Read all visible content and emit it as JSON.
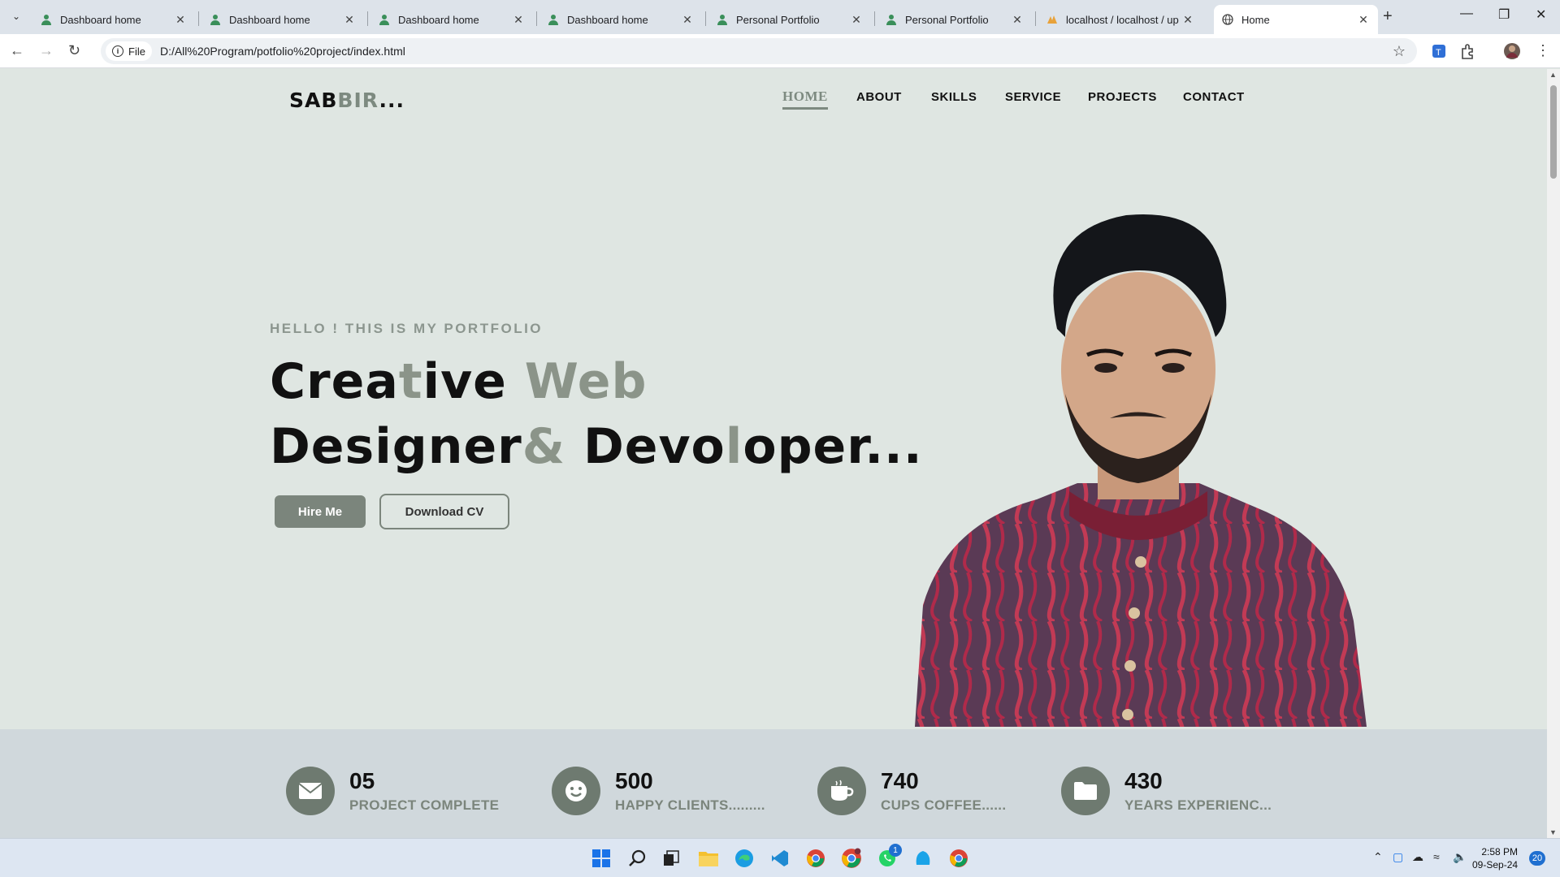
{
  "browser": {
    "tabs": [
      {
        "title": "Dashboard home",
        "icon": "person-icon"
      },
      {
        "title": "Dashboard home",
        "icon": "person-icon"
      },
      {
        "title": "Dashboard home",
        "icon": "person-icon"
      },
      {
        "title": "Dashboard home",
        "icon": "person-icon"
      },
      {
        "title": "Personal Portfolio",
        "icon": "person-icon"
      },
      {
        "title": "Personal Portfolio",
        "icon": "person-icon"
      },
      {
        "title": "localhost / localhost / up",
        "icon": "phpmyadmin-icon"
      },
      {
        "title": "Home",
        "icon": "globe-icon"
      }
    ],
    "active_tab": 7,
    "site_chip": "File",
    "url": "D:/All%20Program/potfolio%20project/index.html"
  },
  "page": {
    "logo": {
      "main": "SAB",
      "accent": "BIR",
      "suffix": "..."
    },
    "nav": [
      "HOME",
      "ABOUT",
      "SKILLS",
      "SERVICE",
      "PROJECTS",
      "CONTACT"
    ],
    "nav_active": "HOME",
    "hello": "HELLO ! THIS IS MY PORTFOLIO",
    "heading_line1": {
      "a": "Crea",
      "b": "t",
      "c": "ive ",
      "d": "Web"
    },
    "heading_line2": {
      "a": "Designer",
      "b": "&",
      "c": " Devo",
      "d": "l",
      "e": "oper..."
    },
    "hire_label": "Hire Me",
    "download_label": "Download CV",
    "stats": [
      {
        "value": "05",
        "label": "PROJECT COMPLETE",
        "icon": "envelope-icon"
      },
      {
        "value": "500",
        "label": "HAPPY CLIENTS.........",
        "icon": "smile-icon"
      },
      {
        "value": "740",
        "label": "CUPS COFFEE......",
        "icon": "coffee-icon"
      },
      {
        "value": "430",
        "label": "YEARS EXPERIENC...",
        "icon": "folder-icon"
      }
    ],
    "colors": {
      "accent": "#7d8a80",
      "background": "#dfe6e2",
      "stats_band": "#d0d8dc"
    }
  },
  "taskbar": {
    "time": "2:58 PM",
    "date": "09-Sep-24",
    "notification_count": "20",
    "whatsapp_badge": "1"
  }
}
